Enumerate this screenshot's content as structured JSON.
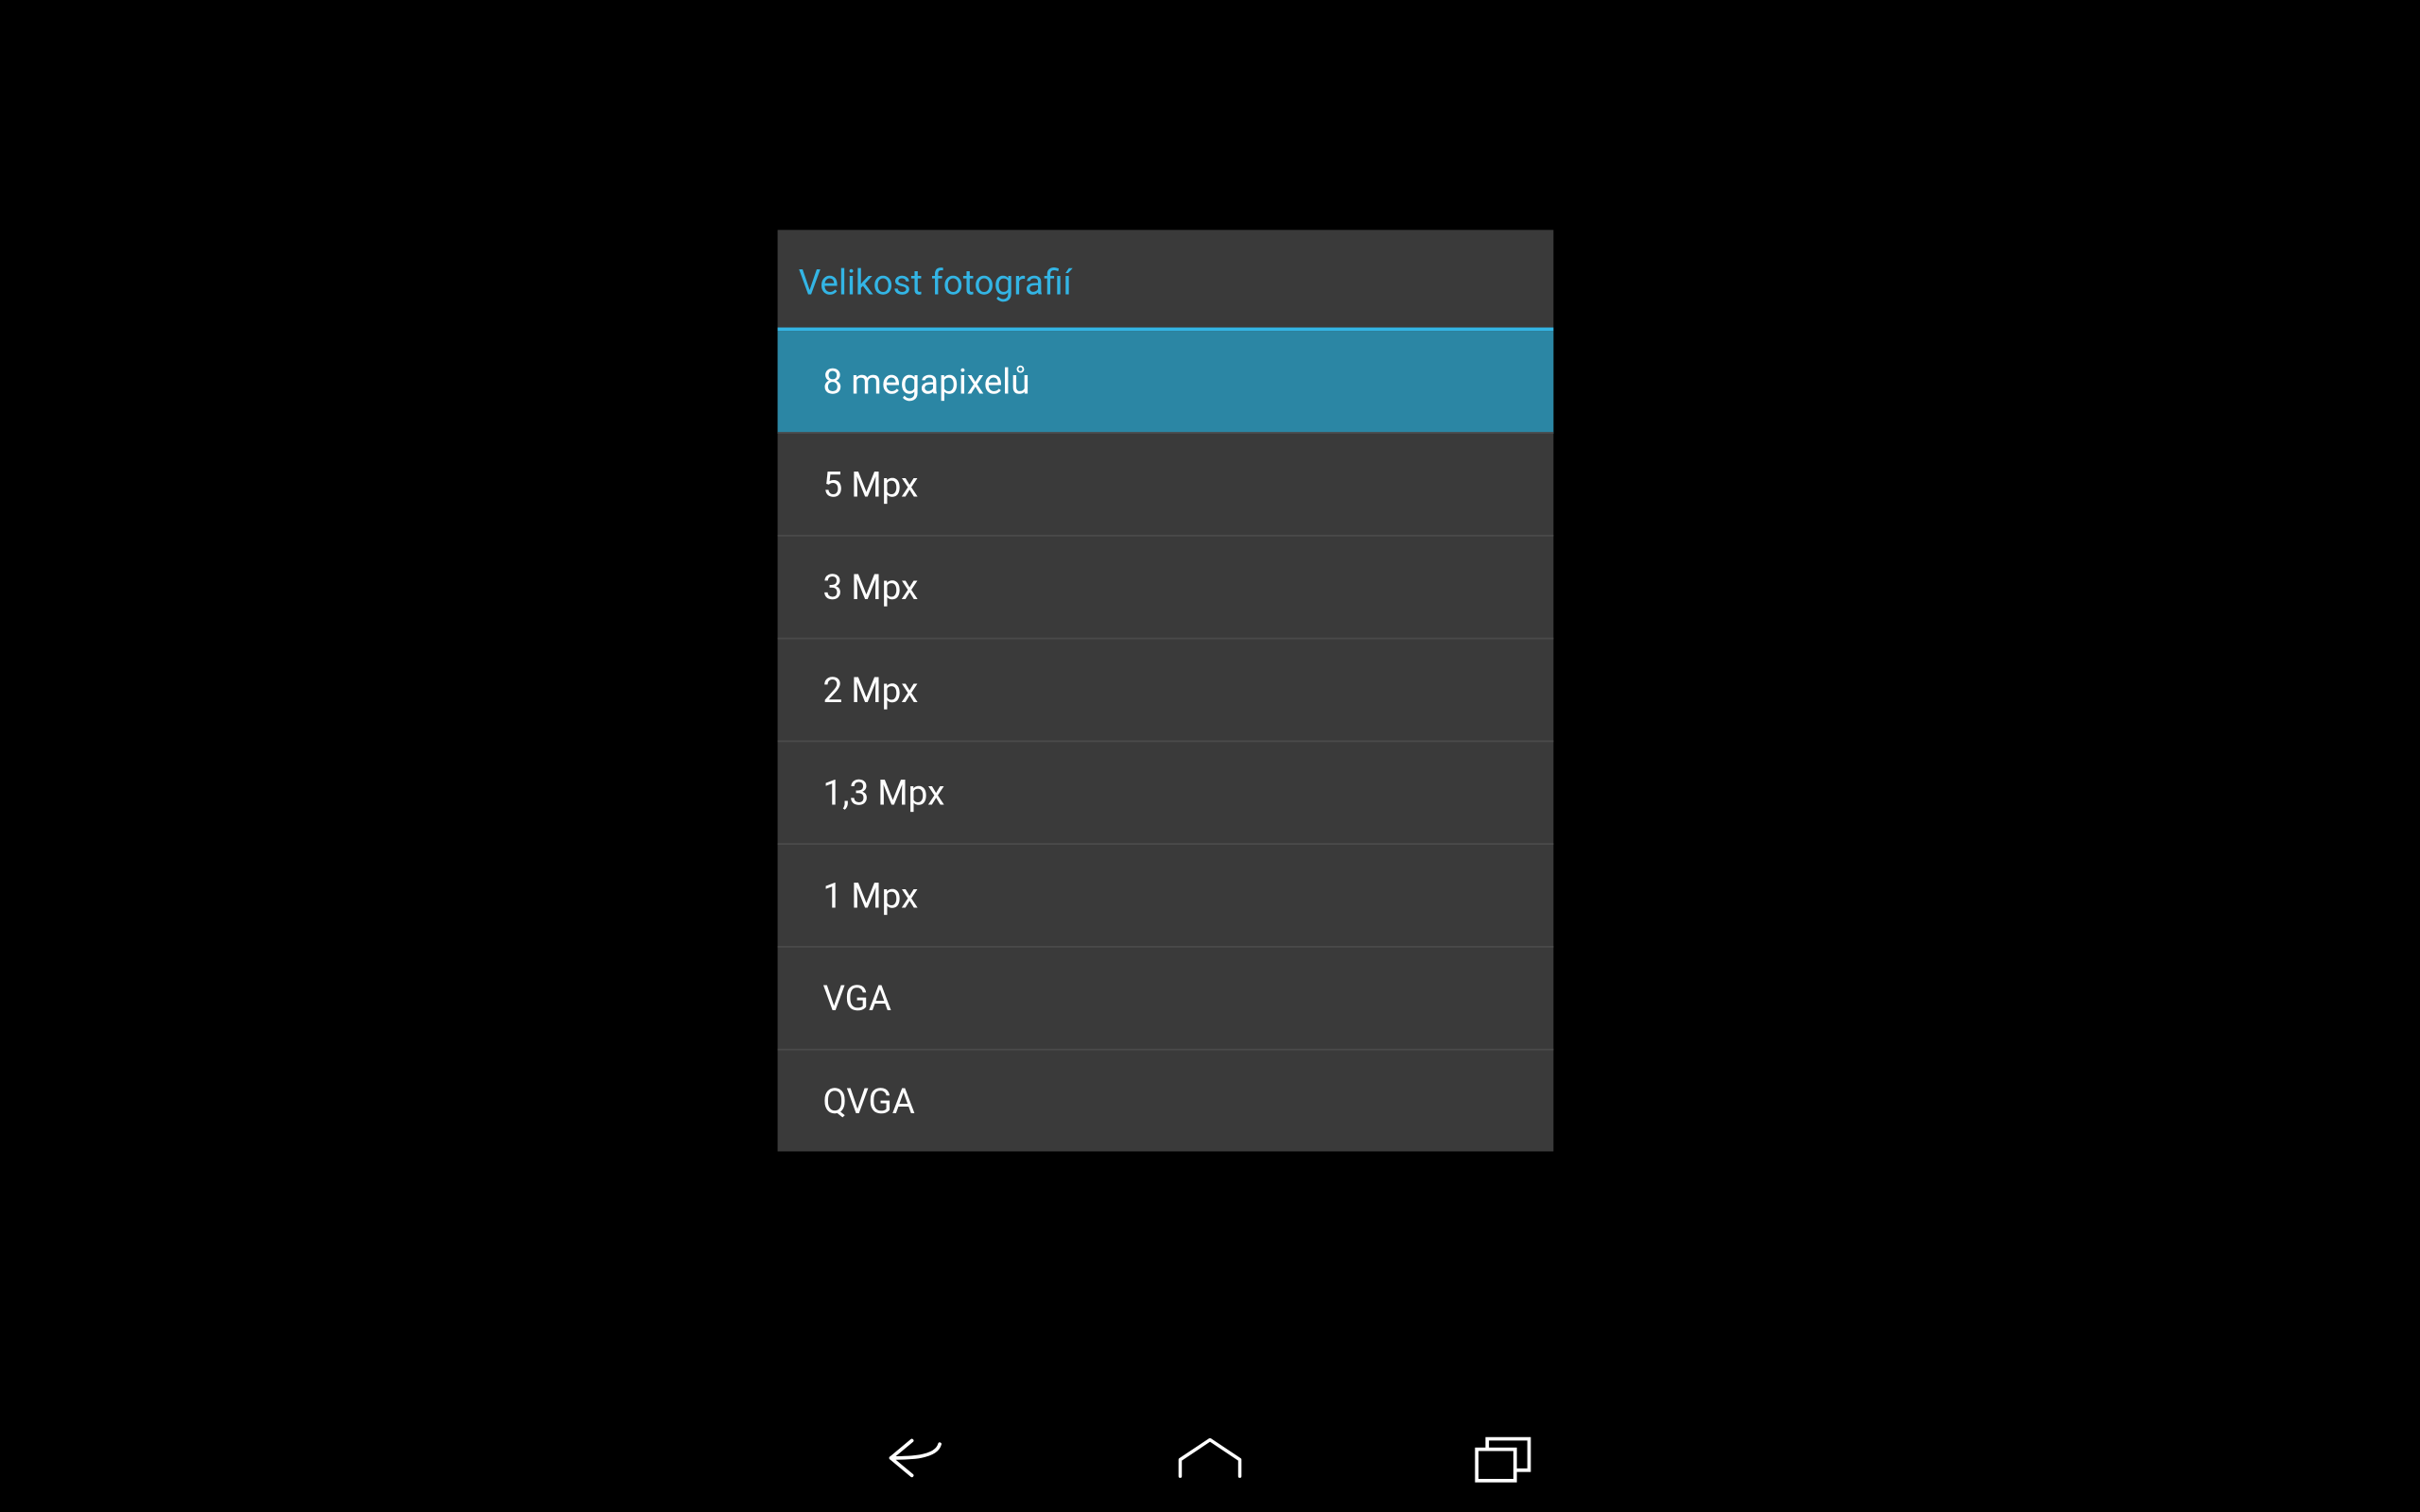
{
  "dialog": {
    "title": "Velikost fotografií",
    "options": [
      {
        "label": "8 megapixelů",
        "selected": true
      },
      {
        "label": "5 Mpx",
        "selected": false
      },
      {
        "label": "3 Mpx",
        "selected": false
      },
      {
        "label": "2 Mpx",
        "selected": false
      },
      {
        "label": "1,3 Mpx",
        "selected": false
      },
      {
        "label": "1 Mpx",
        "selected": false
      },
      {
        "label": "VGA",
        "selected": false
      },
      {
        "label": "QVGA",
        "selected": false
      }
    ]
  },
  "colors": {
    "accent": "#33b5e5",
    "selectedBg": "#2b86a4",
    "dialogBg": "#3a3a3a"
  }
}
